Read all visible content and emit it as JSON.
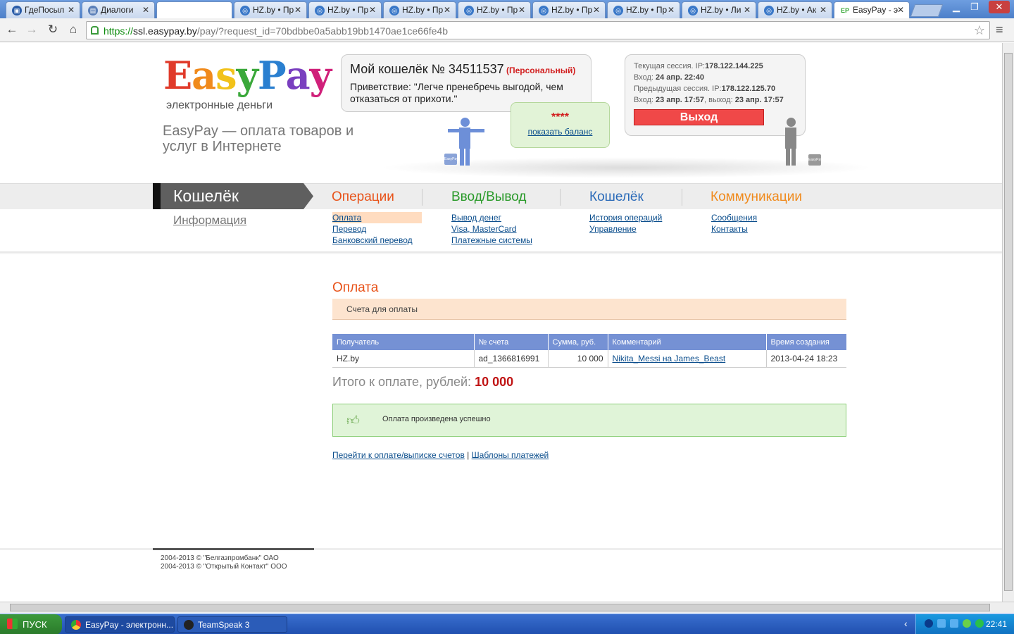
{
  "browser": {
    "tabs": [
      {
        "label": "ГдеПосыл",
        "favicon": "chat-icon"
      },
      {
        "label": "Диалоги",
        "favicon": "chat-icon"
      },
      {
        "label": "",
        "favicon": ""
      },
      {
        "label": "HZ.by • Пр",
        "favicon": "hz-icon"
      },
      {
        "label": "HZ.by • Пр",
        "favicon": "hz-icon"
      },
      {
        "label": "HZ.by • Пр",
        "favicon": "hz-icon"
      },
      {
        "label": "HZ.by • Пр",
        "favicon": "hz-icon"
      },
      {
        "label": "HZ.by • Пр",
        "favicon": "hz-icon"
      },
      {
        "label": "HZ.by • Пр",
        "favicon": "hz-icon"
      },
      {
        "label": "HZ.by • Ли",
        "favicon": "hz-icon"
      },
      {
        "label": "HZ.by • Ак",
        "favicon": "hz-icon"
      },
      {
        "label": "EasyPay - э",
        "favicon": "easypay-icon"
      }
    ],
    "url_scheme": "https://",
    "url_host": "ssl.easypay.by",
    "url_path": "/pay/?request_id=70bdbbe0a5abb19bb1470ae1ce66fe4b"
  },
  "logo": {
    "letters": [
      "E",
      "a",
      "s",
      "y",
      "P",
      "a",
      "y"
    ],
    "colors": [
      "#e03a2a",
      "#f08a1c",
      "#f2c21a",
      "#3aa83a",
      "#2a7fd0",
      "#7a3fbf",
      "#d0207a"
    ],
    "subtitle": "электронные деньги"
  },
  "tagline": "EasyPay — оплата товаров и услуг в Интернете",
  "wallet": {
    "title": "Мой кошелёк № 34511537",
    "type": "(Персональный)",
    "greeting": "Приветствие: \"Легче пренебречь выгодой, чем отказаться от прихоти.\"",
    "balance_hidden": "****",
    "show_balance": "показать баланс"
  },
  "session": {
    "current_label": "Текущая сессия. IP:",
    "current_ip": "178.122.144.225",
    "login_label": "Вход:",
    "login_time": "24 апр. 22:40",
    "prev_label": "Предыдущая сессия. IP:",
    "prev_ip": "178.122.125.70",
    "prev_login_label": "Вход:",
    "prev_login_time": "23 апр. 17:57",
    "prev_logout_label": ", выход:",
    "prev_logout_time": "23 апр. 17:57",
    "logout_button": "Выход"
  },
  "nav": {
    "section_title": "Кошелёк",
    "info_link": "Информация",
    "categories": [
      {
        "label": "Операции",
        "color": "#e8531a",
        "links": [
          "Оплата",
          "Перевод",
          "Банковский перевод"
        ]
      },
      {
        "label": "Ввод/Вывод",
        "color": "#2a9a2a",
        "links": [
          "Вывод денег",
          "Visa, MasterCard",
          "Платежные системы"
        ]
      },
      {
        "label": "Кошелёк",
        "color": "#2a6ab8",
        "links": [
          "История операций",
          "Управление"
        ]
      },
      {
        "label": "Коммуникации",
        "color": "#f08a1c",
        "links": [
          "Сообщения",
          "Контакты"
        ]
      }
    ]
  },
  "content": {
    "title": "Оплата",
    "invoices_header": "Счета для оплаты",
    "table": {
      "columns": [
        "Получатель",
        "№ счета",
        "Сумма, руб.",
        "Комментарий",
        "Время создания"
      ],
      "rows": [
        [
          "HZ.by",
          "ad_1366816991",
          "10 000",
          "Nikita_Messi на James_Beast",
          "2013-04-24 18:23"
        ]
      ]
    },
    "total_label": "Итого к оплате, рублей:",
    "total_value": "10 000",
    "success_message": "Оплата произведена успешно",
    "link_invoices": "Перейти к оплате/выписке счетов",
    "link_separator": "|",
    "link_templates": "Шаблоны платежей"
  },
  "footer": {
    "line1": "2004-2013 © \"Белгазпромбанк\" ОАО",
    "line2": "2004-2013 © \"Открытый Контакт\" ООО"
  },
  "taskbar": {
    "start": "ПУСК",
    "tasks": [
      "EasyPay - электронн...",
      "TeamSpeak 3"
    ],
    "clock": "22:41"
  }
}
